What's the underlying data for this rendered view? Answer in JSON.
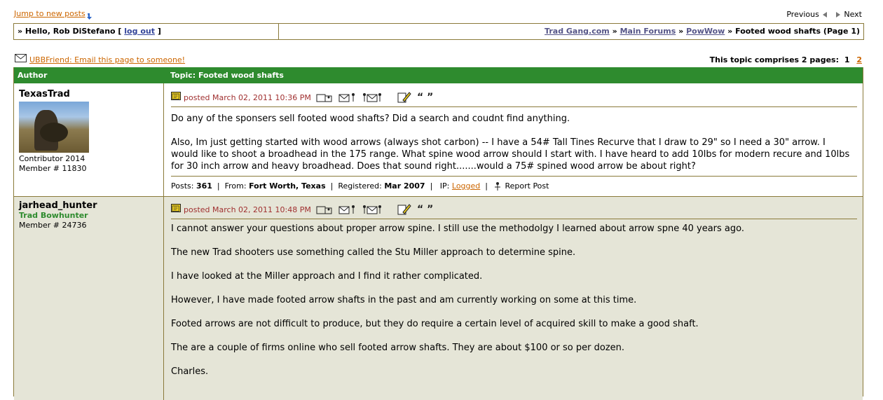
{
  "nav": {
    "jump_label": "Jump to new posts",
    "previous_label": "Previous",
    "next_label": "Next"
  },
  "hello": {
    "prefix": "» Hello, Rob DiStefano [",
    "logout": "log out",
    "suffix": "]"
  },
  "breadcrumb": {
    "items": [
      "Trad Gang.com",
      "Main Forums",
      "PowWow"
    ],
    "sep": "»",
    "current": "Footed wood shafts (Page 1)"
  },
  "ubbfriend": {
    "link": "UBBFriend: Email this page to someone!",
    "pages_label": "This topic comprises 2 pages:",
    "page_current": "1",
    "page_other": "2"
  },
  "table": {
    "author_header": "Author",
    "topic_header": "Topic: Footed wood shafts"
  },
  "posts": [
    {
      "username": "TexasTrad",
      "title": "",
      "line1": "Contributor 2014",
      "line2": "Member # 11830",
      "date": "posted March 02, 2011 10:36 PM",
      "paragraphs": [
        "Do any of the sponsers sell footed wood shafts? Did a search and coudnt find anything.",
        "Also, Im just getting started with wood arrows (always shot carbon) -- I have a 54# Tall Tines Recurve that I draw to 29\" so I need a 30\" arrow. I would like to shoot a broadhead in the 175 range. What spine wood arrow should I start with. I have heard to add 10lbs for modern recure and 10lbs for 30 inch arrow and heavy broadhead. Does that sound right.......would a 75# spined wood arrow be about right?"
      ],
      "footer": {
        "posts_label": "Posts:",
        "posts": "361",
        "from_label": "From:",
        "from": "Fort Worth, Texas",
        "registered_label": "Registered:",
        "registered": "Mar 2007",
        "ip_label": "IP:",
        "ip_link": "Logged",
        "report": "Report Post"
      }
    },
    {
      "username": "jarhead_hunter",
      "title": "Trad Bowhunter",
      "line1": "Member # 24736",
      "line2": "",
      "date": "posted March 02, 2011 10:48 PM",
      "paragraphs": [
        "I cannot answer your questions about proper arrow spine. I still use the methodolgy I learned about arrow spne 40 years ago.",
        "The new Trad shooters use something called the Stu Miller approach to determine spine.",
        "I have looked at the Miller approach and I find it rather complicated.",
        "However, I have made footed arrow shafts in the past and am currently working on some at this time.",
        "Footed arrows are not difficult to produce, but they do require a certain level of acquired skill to make a good shaft.",
        "The are a couple of firms online who sell footed arrow shafts. They are about $100 or so per dozen.",
        "Charles."
      ]
    }
  ],
  "icons": {
    "quote": "“ ”"
  }
}
